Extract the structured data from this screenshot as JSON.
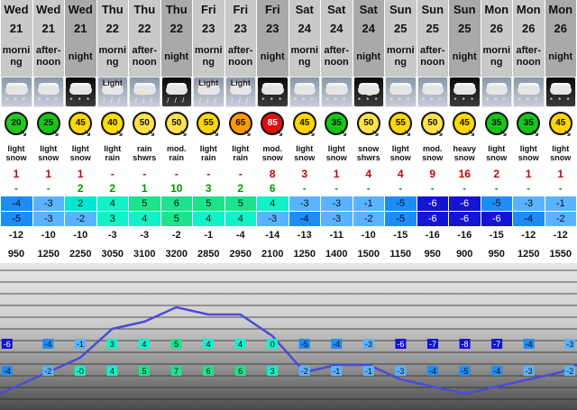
{
  "columns": [
    {
      "day": "Wed",
      "date": "21",
      "time": "morning",
      "type": "day",
      "icon": "light-snow-day-icon",
      "icon_label": "",
      "wind": "20",
      "wind_color": "#22c81e",
      "wind_text": "#111111",
      "summary": "light snow",
      "snow": "1",
      "rain": "-",
      "max": "-4",
      "max_color": "#1e8cf5",
      "min": "-5",
      "min_color": "#1e8cf5",
      "chill": "-12",
      "freeze": "950"
    },
    {
      "day": "Wed",
      "date": "21",
      "time": "after-noon",
      "type": "day",
      "icon": "light-snow-day-icon",
      "icon_label": "",
      "wind": "25",
      "wind_color": "#16c41a",
      "wind_text": "#111111",
      "summary": "light snow",
      "snow": "1",
      "rain": "-",
      "max": "-3",
      "max_color": "#5ab3ff",
      "min": "-3",
      "min_color": "#5ab3ff",
      "chill": "-10",
      "freeze": "1250"
    },
    {
      "day": "Wed",
      "date": "21",
      "time": "night",
      "type": "night",
      "icon": "light-snow-night-icon",
      "icon_label": "",
      "wind": "45",
      "wind_color": "#ffd600",
      "wind_text": "#111111",
      "summary": "light snow",
      "snow": "1",
      "rain": "2",
      "max": "2",
      "max_color": "#00e6d0",
      "min": "-2",
      "min_color": "#5ab3ff",
      "chill": "-10",
      "freeze": "2250"
    },
    {
      "day": "Thu",
      "date": "22",
      "time": "morning",
      "type": "day",
      "icon": "light-rain-day-icon",
      "icon_label": "Light",
      "wind": "40",
      "wind_color": "#ffdd00",
      "wind_text": "#111111",
      "summary": "light rain",
      "snow": "-",
      "rain": "2",
      "max": "4",
      "max_color": "#14f0c8",
      "min": "3",
      "min_color": "#14f0c8",
      "chill": "-3",
      "freeze": "3050"
    },
    {
      "day": "Thu",
      "date": "22",
      "time": "after-noon",
      "type": "day",
      "icon": "rain-showers-sun-icon",
      "icon_label": "",
      "wind": "50",
      "wind_color": "#ffe24a",
      "wind_text": "#111111",
      "summary": "rain shwrs",
      "snow": "-",
      "rain": "1",
      "max": "5",
      "max_color": "#1ee28c",
      "min": "4",
      "min_color": "#14f0c8",
      "chill": "-3",
      "freeze": "3100"
    },
    {
      "day": "Thu",
      "date": "22",
      "time": "night",
      "type": "night",
      "icon": "mod-rain-night-icon",
      "icon_label": "",
      "wind": "50",
      "wind_color": "#ffe24a",
      "wind_text": "#111111",
      "summary": "mod. rain",
      "snow": "-",
      "rain": "10",
      "max": "6",
      "max_color": "#1ee28c",
      "min": "5",
      "min_color": "#1ee28c",
      "chill": "-2",
      "freeze": "3200"
    },
    {
      "day": "Fri",
      "date": "23",
      "time": "morning",
      "type": "day",
      "icon": "light-rain-day-icon",
      "icon_label": "Light",
      "wind": "55",
      "wind_color": "#ffd600",
      "wind_text": "#111111",
      "summary": "light rain",
      "snow": "-",
      "rain": "3",
      "max": "5",
      "max_color": "#1ee28c",
      "min": "4",
      "min_color": "#14f0c8",
      "chill": "-1",
      "freeze": "2850"
    },
    {
      "day": "Fri",
      "date": "23",
      "time": "after-noon",
      "type": "day",
      "icon": "light-rain-day-icon",
      "icon_label": "Light",
      "wind": "65",
      "wind_color": "#ff9a00",
      "wind_text": "#111111",
      "summary": "light rain",
      "snow": "-",
      "rain": "2",
      "max": "5",
      "max_color": "#1ee28c",
      "min": "4",
      "min_color": "#14f0c8",
      "chill": "-4",
      "freeze": "2950"
    },
    {
      "day": "Fri",
      "date": "23",
      "time": "night",
      "type": "night",
      "icon": "mod-snow-night-icon",
      "icon_label": "",
      "wind": "85",
      "wind_color": "#e01010",
      "wind_text": "#ffffff",
      "summary": "mod. snow",
      "snow": "8",
      "rain": "6",
      "max": "4",
      "max_color": "#14f0c8",
      "min": "-3",
      "min_color": "#5ab3ff",
      "chill": "-14",
      "freeze": "2100"
    },
    {
      "day": "Sat",
      "date": "24",
      "time": "morning",
      "type": "day",
      "icon": "light-snow-day-icon",
      "icon_label": "",
      "wind": "45",
      "wind_color": "#ffd600",
      "wind_text": "#111111",
      "summary": "light snow",
      "snow": "3",
      "rain": "-",
      "max": "-3",
      "max_color": "#5ab3ff",
      "min": "-4",
      "min_color": "#1e8cf5",
      "chill": "-13",
      "freeze": "1250"
    },
    {
      "day": "Sat",
      "date": "24",
      "time": "after-noon",
      "type": "day",
      "icon": "light-snow-day-icon",
      "icon_label": "",
      "wind": "35",
      "wind_color": "#16c41a",
      "wind_text": "#111111",
      "summary": "light snow",
      "snow": "1",
      "rain": "-",
      "max": "-3",
      "max_color": "#5ab3ff",
      "min": "-3",
      "min_color": "#5ab3ff",
      "chill": "-11",
      "freeze": "1400"
    },
    {
      "day": "Sat",
      "date": "24",
      "time": "night",
      "type": "night",
      "icon": "snow-showers-moon-icon",
      "icon_label": "",
      "wind": "50",
      "wind_color": "#ffe24a",
      "wind_text": "#111111",
      "summary": "snow shwrs",
      "snow": "4",
      "rain": "-",
      "max": "-1",
      "max_color": "#5ab3ff",
      "min": "-2",
      "min_color": "#5ab3ff",
      "chill": "-10",
      "freeze": "1500"
    },
    {
      "day": "Sun",
      "date": "25",
      "time": "morning",
      "type": "day",
      "icon": "light-snow-day-icon",
      "icon_label": "",
      "wind": "55",
      "wind_color": "#ffd600",
      "wind_text": "#111111",
      "summary": "light snow",
      "snow": "4",
      "rain": "-",
      "max": "-5",
      "max_color": "#1e8cf5",
      "min": "-5",
      "min_color": "#1e8cf5",
      "chill": "-15",
      "freeze": "1150"
    },
    {
      "day": "Sun",
      "date": "25",
      "time": "after-noon",
      "type": "day",
      "icon": "mod-snow-day-icon",
      "icon_label": "",
      "wind": "50",
      "wind_color": "#ffe24a",
      "wind_text": "#111111",
      "summary": "mod. snow",
      "snow": "9",
      "rain": "-",
      "max": "-6",
      "max_color": "#1414d2",
      "min": "-6",
      "min_color": "#1414d2",
      "chill": "-16",
      "freeze": "950"
    },
    {
      "day": "Sun",
      "date": "25",
      "time": "night",
      "type": "night",
      "icon": "heavy-snow-night-icon",
      "icon_label": "",
      "wind": "45",
      "wind_color": "#ffd600",
      "wind_text": "#111111",
      "summary": "heavy snow",
      "snow": "16",
      "rain": "-",
      "max": "-6",
      "max_color": "#1414d2",
      "min": "-6",
      "min_color": "#1414d2",
      "chill": "-16",
      "freeze": "900"
    },
    {
      "day": "Mon",
      "date": "26",
      "time": "morning",
      "type": "day",
      "icon": "light-snow-day-icon",
      "icon_label": "",
      "wind": "35",
      "wind_color": "#16c41a",
      "wind_text": "#111111",
      "summary": "light snow",
      "snow": "2",
      "rain": "-",
      "max": "-5",
      "max_color": "#1e8cf5",
      "min": "-6",
      "min_color": "#1414d2",
      "chill": "-15",
      "freeze": "950"
    },
    {
      "day": "Mon",
      "date": "26",
      "time": "after-noon",
      "type": "day",
      "icon": "light-snow-day-icon",
      "icon_label": "",
      "wind": "35",
      "wind_color": "#16c41a",
      "wind_text": "#111111",
      "summary": "light snow",
      "snow": "1",
      "rain": "-",
      "max": "-3",
      "max_color": "#5ab3ff",
      "min": "-4",
      "min_color": "#1e8cf5",
      "chill": "-12",
      "freeze": "1250"
    },
    {
      "day": "Mon",
      "date": "26",
      "time": "night",
      "type": "night",
      "icon": "light-snow-night-icon",
      "icon_label": "",
      "wind": "45",
      "wind_color": "#ffd600",
      "wind_text": "#111111",
      "summary": "light snow",
      "snow": "1",
      "rain": "-",
      "max": "-1",
      "max_color": "#5ab3ff",
      "min": "-2",
      "min_color": "#5ab3ff",
      "chill": "-12",
      "freeze": "1550"
    }
  ],
  "chart": {
    "top_labels": [
      "-6",
      "-4",
      "-1",
      "3",
      "4",
      "5",
      "4",
      "4",
      "0",
      "-5",
      "-4",
      "-3",
      "-6",
      "-7",
      "-8",
      "-7",
      "-4",
      "-3"
    ],
    "bottom_labels": [
      "-4",
      "-2",
      "-0",
      "4",
      "5",
      "7",
      "6",
      "6",
      "3",
      "-2",
      "-1",
      "-1",
      "-3",
      "-4",
      "-5",
      "-4",
      "-3",
      "-2"
    ],
    "line_color": "#4b4bd8"
  }
}
